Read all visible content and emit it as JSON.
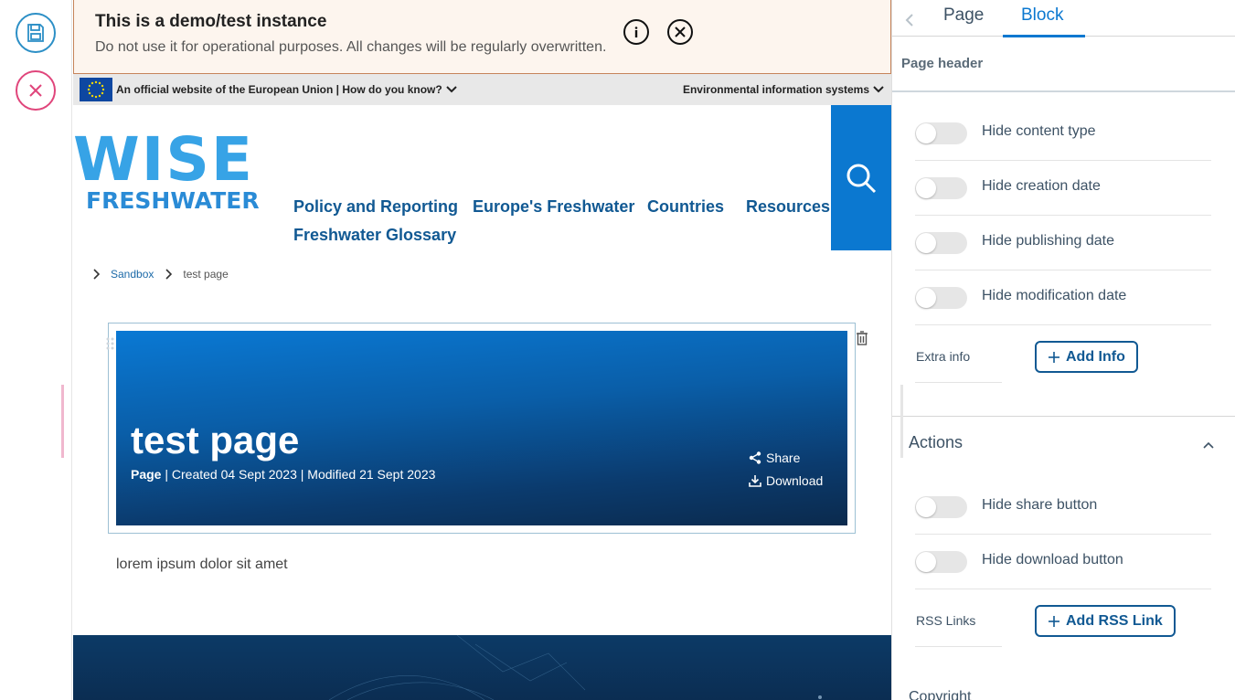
{
  "demo_banner": {
    "title": "This is a demo/test instance",
    "text": "Do not use it for operational purposes. All changes will be regularly overwritten."
  },
  "eu_bar": {
    "official_text": "An official website of the European Union | How do you know?",
    "right_text": "Environmental information systems"
  },
  "logo": {
    "wise": "WISE",
    "freshwater": "FRESHWATER"
  },
  "nav": {
    "items": [
      "Policy and Reporting",
      "Europe's Freshwater",
      "Countries",
      "Resources",
      "Freshwater Glossary"
    ]
  },
  "breadcrumb": {
    "items": [
      "Sandbox",
      "test page"
    ]
  },
  "hero": {
    "title": "test page",
    "type": "Page",
    "meta": " | Created 04 Sept 2023 | Modified 21 Sept 2023",
    "share": "Share",
    "download": "Download"
  },
  "body": {
    "text": "lorem ipsum dolor sit amet"
  },
  "sidebar": {
    "tabs": [
      "Page",
      "Block"
    ],
    "active_tab": "Block",
    "section_title": "Page header",
    "header_toggles": [
      "Hide content type",
      "Hide creation date",
      "Hide publishing date",
      "Hide modification date"
    ],
    "extra_info_label": "Extra info",
    "add_info_label": "Add Info",
    "actions_title": "Actions",
    "action_toggles": [
      "Hide share button",
      "Hide download button"
    ],
    "rss_label": "RSS Links",
    "add_rss_label": "Add RSS Link",
    "next_section_partial": "Copyright"
  },
  "colors": {
    "accent": "#0b78d0",
    "nav_text": "#115993",
    "save_ring": "#2c8fc6",
    "cancel_ring": "#e0457b",
    "banner_bg": "#fdf5ee"
  }
}
